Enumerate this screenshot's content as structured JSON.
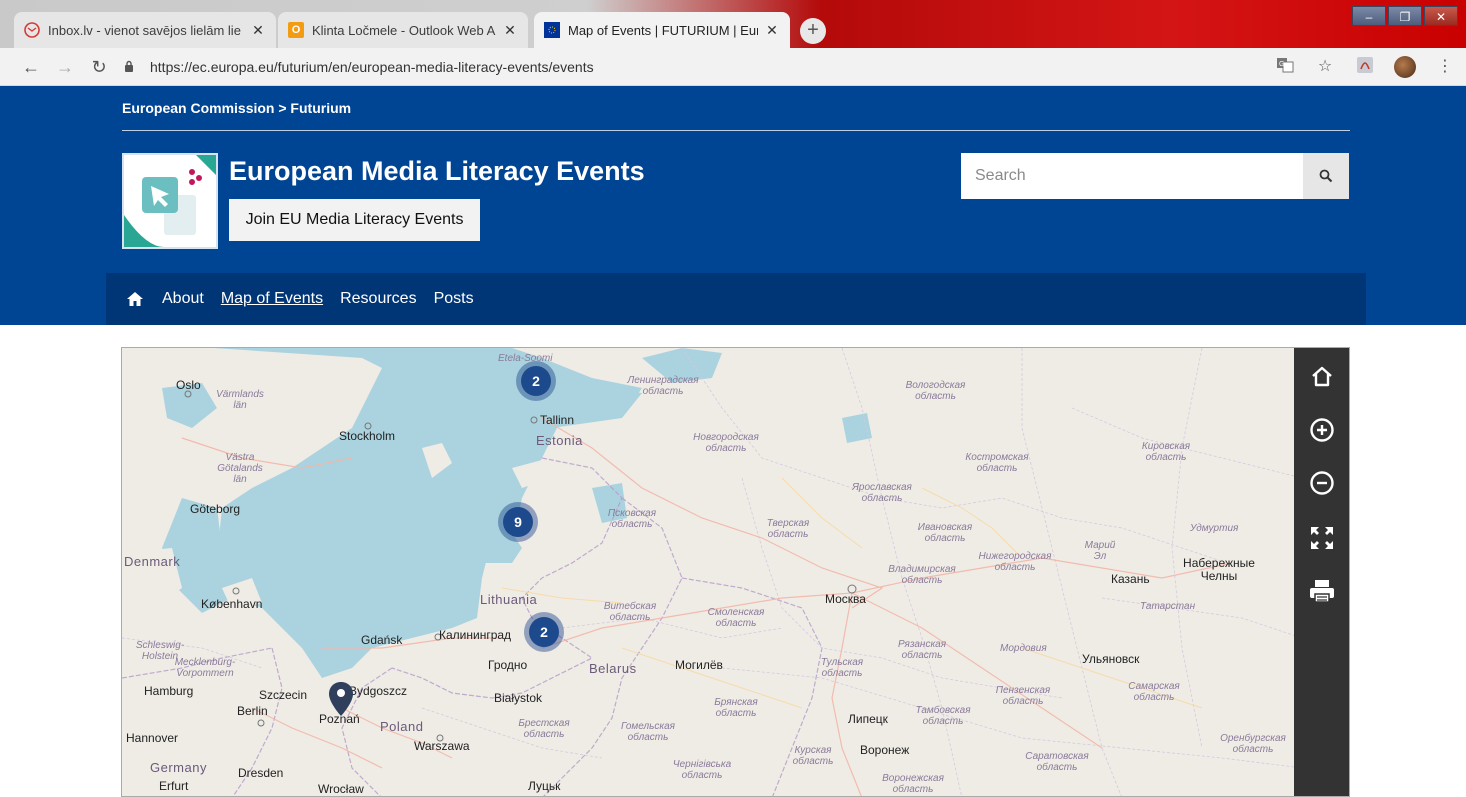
{
  "browser": {
    "tabs": [
      {
        "title": "Inbox.lv - vienot savējos lielām lie",
        "icon": "envelope-icon"
      },
      {
        "title": "Klinta Ločmele - Outlook Web Ap",
        "icon": "outlook-icon"
      },
      {
        "title": "Map of Events | FUTURIUM | Euro",
        "icon": "eu-flag-icon"
      }
    ],
    "new_tab": "+",
    "url": "https://ec.europa.eu/futurium/en/european-media-literacy-events/events"
  },
  "header": {
    "breadcrumb": "European Commission > Futurium",
    "title": "European Media Literacy Events",
    "join_label": "Join EU Media Literacy Events",
    "search_placeholder": "Search"
  },
  "nav": {
    "items": [
      "About",
      "Map of Events",
      "Resources",
      "Posts"
    ],
    "current": "Map of Events"
  },
  "map": {
    "clusters": [
      "2",
      "9",
      "2"
    ],
    "countries": [
      "Estonia",
      "Lithuania",
      "Belarus",
      "Poland",
      "Denmark",
      "Germany"
    ],
    "cities": [
      "Oslo",
      "Stockholm",
      "Tallinn",
      "Göteborg",
      "København",
      "Gdańsk",
      "Калининград",
      "Гродно",
      "Могилёв",
      "Białystok",
      "Poznań",
      "Warszawa",
      "Berlin",
      "Szczecin",
      "Hamburg",
      "Hannover",
      "Dresden",
      "Wrocław",
      "Erfurt",
      "Bydgoszcz",
      "Москва",
      "Казань",
      "Набережные Челны",
      "Ульяновск",
      "Липецк",
      "Воронеж",
      "Луцьк"
    ],
    "regions": [
      "Etela-Soomi",
      "Ленинградская область",
      "Вологодская область",
      "Värmlands län",
      "Västra Götalands län",
      "Новгородская область",
      "Костромская область",
      "Кировская область",
      "Ярославская область",
      "Псковская область",
      "Тверская область",
      "Ивановская область",
      "Удмуртия",
      "Нижегородская область",
      "Марий Эл",
      "Владимирская область",
      "Витебская область",
      "Смоленская область",
      "Татарстан",
      "Рязанская область",
      "Мордовия",
      "Тульская область",
      "Schleswig-Holstein",
      "Mecklenburg-Vorpommern",
      "Брянская область",
      "Пензенская область",
      "Самарская область",
      "Брестская область",
      "Гомельская область",
      "Тамбовская область",
      "Курская область",
      "Саратовская область",
      "Оренбургская область",
      "Чернігівська область",
      "Воронежская область"
    ],
    "tools": [
      "home-icon",
      "zoom-in-icon",
      "zoom-out-icon",
      "fullscreen-icon",
      "print-icon"
    ]
  }
}
